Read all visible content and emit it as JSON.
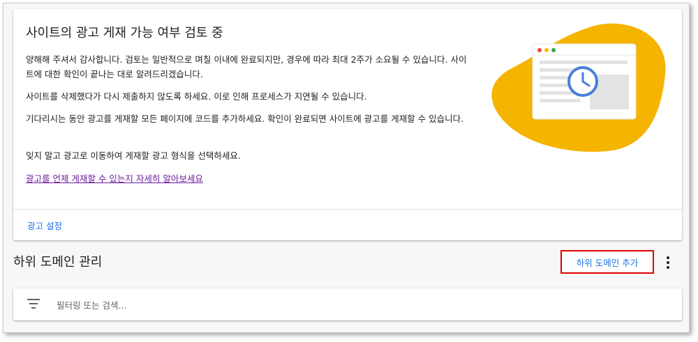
{
  "review_card": {
    "title": "사이트의 광고 게재 가능 여부 검토 중",
    "paragraphs": [
      "양해해 주셔서 감사합니다. 검토는 일반적으로 며칠 이내에 완료되지만, 경우에 따라 최대 2주가 소요될 수 있습니다. 사이트에 대한 확인이 끝나는 대로 알려드리겠습니다.",
      "사이트를 삭제했다가 다시 제출하지 않도록 하세요. 이로 인해 프로세스가 지연될 수 있습니다.",
      "기다리시는 동안 광고를 게재할 모든 페이지에 코드를 추가하세요. 확인이 완료되면 사이트에 광고를 게재할 수 있습니다.",
      "잊지 말고 광고로 이동하여 게재할 광고 형식을 선택하세요."
    ],
    "learn_more_link": "광고를 언제 게재할 수 있는지 자세히 알아보세요",
    "ad_settings_link": "광고 설정",
    "illustration_icon": "browser-window-clock-icon"
  },
  "subdomains": {
    "title": "하위 도메인 관리",
    "add_button": "하위 도메인 추가",
    "more_icon": "more-vert-icon",
    "filter_icon": "filter-list-icon",
    "filter_placeholder": "필터링 또는 검색..."
  },
  "colors": {
    "accent_link": "#1a73e8",
    "visited_link": "#6a1b9a",
    "highlight_border": "#e00000",
    "blob": "#f5b400",
    "clock": "#4a7fd8"
  }
}
